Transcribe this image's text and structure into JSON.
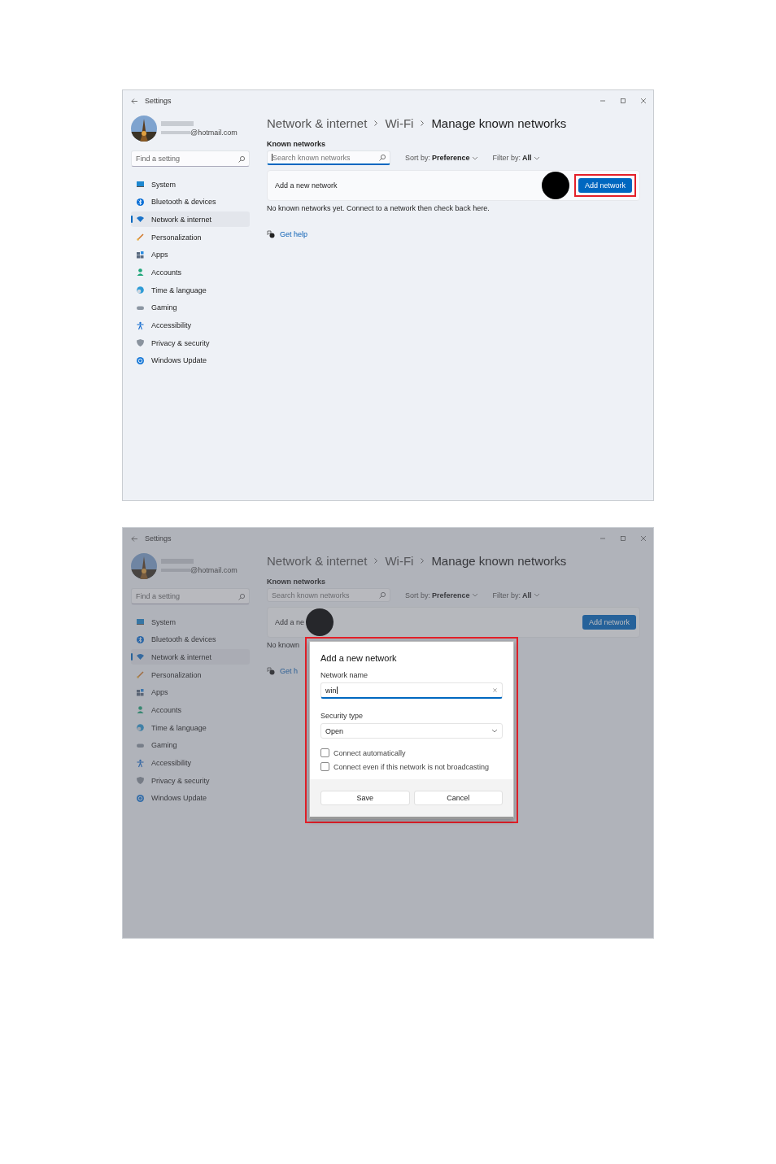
{
  "screenshots": [
    {
      "window": {
        "title": "Settings"
      },
      "dimmed": false,
      "account": {
        "email": "@hotmail.com"
      },
      "search": {
        "placeholder": "Find a setting"
      },
      "sidebar": {
        "items": [
          {
            "label": "System",
            "selected": false
          },
          {
            "label": "Bluetooth & devices",
            "selected": false
          },
          {
            "label": "Network & internet",
            "selected": true
          },
          {
            "label": "Personalization",
            "selected": false
          },
          {
            "label": "Apps",
            "selected": false
          },
          {
            "label": "Accounts",
            "selected": false
          },
          {
            "label": "Time & language",
            "selected": false
          },
          {
            "label": "Gaming",
            "selected": false
          },
          {
            "label": "Accessibility",
            "selected": false
          },
          {
            "label": "Privacy & security",
            "selected": false
          },
          {
            "label": "Windows Update",
            "selected": false
          }
        ]
      },
      "breadcrumb": [
        "Network & internet",
        "Wi-Fi",
        "Manage known networks"
      ],
      "section_title": "Known networks",
      "network_search": {
        "placeholder": "Search known networks",
        "focused": true
      },
      "sort": {
        "label": "Sort by:",
        "value": "Preference"
      },
      "filter": {
        "label": "Filter by:",
        "value": "All"
      },
      "add_row": {
        "label": "Add a new network",
        "marker": {
          "kind": "button"
        },
        "button": {
          "label": "Add network",
          "highlighted": true
        }
      },
      "empty_message": "No known networks yet. Connect to a network then check back here.",
      "help_link": "Get help"
    },
    {
      "window": {
        "title": "Settings"
      },
      "dimmed": true,
      "account": {
        "email": "@hotmail.com"
      },
      "search": {
        "placeholder": "Find a setting"
      },
      "sidebar": {
        "items": [
          {
            "label": "System",
            "selected": false
          },
          {
            "label": "Bluetooth & devices",
            "selected": false
          },
          {
            "label": "Network & internet",
            "selected": true
          },
          {
            "label": "Personalization",
            "selected": false
          },
          {
            "label": "Apps",
            "selected": false
          },
          {
            "label": "Accounts",
            "selected": false
          },
          {
            "label": "Time & language",
            "selected": false
          },
          {
            "label": "Gaming",
            "selected": false
          },
          {
            "label": "Accessibility",
            "selected": false
          },
          {
            "label": "Privacy & security",
            "selected": false
          },
          {
            "label": "Windows Update",
            "selected": false
          }
        ]
      },
      "breadcrumb": [
        "Network & internet",
        "Wi-Fi",
        "Manage known networks"
      ],
      "section_title": "Known networks",
      "network_search": {
        "placeholder": "Search known networks",
        "focused": false
      },
      "sort": {
        "label": "Sort by:",
        "value": "Preference"
      },
      "filter": {
        "label": "Filter by:",
        "value": "All"
      },
      "add_row": {
        "label": "Add a ne",
        "marker": {
          "kind": "label"
        },
        "button": {
          "label": "Add network",
          "highlighted": false
        }
      },
      "empty_message": "No known",
      "help_link": "Get h",
      "dialog": {
        "title": "Add a new network",
        "highlighted": true,
        "name_label": "Network name",
        "name_value": "win",
        "security_label": "Security type",
        "security_value": "Open",
        "options": [
          {
            "label": "Connect automatically",
            "checked": false
          },
          {
            "label": "Connect even if this network is not broadcasting",
            "checked": false
          }
        ],
        "buttons": [
          "Save",
          "Cancel"
        ]
      }
    }
  ]
}
